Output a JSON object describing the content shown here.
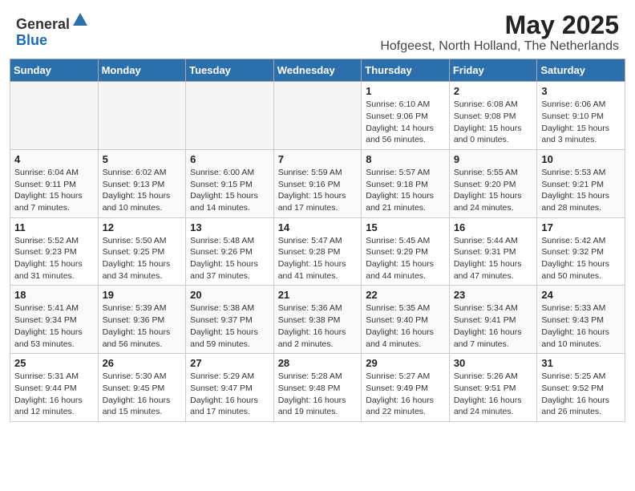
{
  "header": {
    "logo_line1": "General",
    "logo_line2": "Blue",
    "month_year": "May 2025",
    "location": "Hofgeest, North Holland, The Netherlands"
  },
  "days_of_week": [
    "Sunday",
    "Monday",
    "Tuesday",
    "Wednesday",
    "Thursday",
    "Friday",
    "Saturday"
  ],
  "weeks": [
    [
      {
        "num": "",
        "empty": true
      },
      {
        "num": "",
        "empty": true
      },
      {
        "num": "",
        "empty": true
      },
      {
        "num": "",
        "empty": true
      },
      {
        "num": "1",
        "sunrise": "6:10 AM",
        "sunset": "9:06 PM",
        "daylight": "14 hours and 56 minutes."
      },
      {
        "num": "2",
        "sunrise": "6:08 AM",
        "sunset": "9:08 PM",
        "daylight": "15 hours and 0 minutes."
      },
      {
        "num": "3",
        "sunrise": "6:06 AM",
        "sunset": "9:10 PM",
        "daylight": "15 hours and 3 minutes."
      }
    ],
    [
      {
        "num": "4",
        "sunrise": "6:04 AM",
        "sunset": "9:11 PM",
        "daylight": "15 hours and 7 minutes."
      },
      {
        "num": "5",
        "sunrise": "6:02 AM",
        "sunset": "9:13 PM",
        "daylight": "15 hours and 10 minutes."
      },
      {
        "num": "6",
        "sunrise": "6:00 AM",
        "sunset": "9:15 PM",
        "daylight": "15 hours and 14 minutes."
      },
      {
        "num": "7",
        "sunrise": "5:59 AM",
        "sunset": "9:16 PM",
        "daylight": "15 hours and 17 minutes."
      },
      {
        "num": "8",
        "sunrise": "5:57 AM",
        "sunset": "9:18 PM",
        "daylight": "15 hours and 21 minutes."
      },
      {
        "num": "9",
        "sunrise": "5:55 AM",
        "sunset": "9:20 PM",
        "daylight": "15 hours and 24 minutes."
      },
      {
        "num": "10",
        "sunrise": "5:53 AM",
        "sunset": "9:21 PM",
        "daylight": "15 hours and 28 minutes."
      }
    ],
    [
      {
        "num": "11",
        "sunrise": "5:52 AM",
        "sunset": "9:23 PM",
        "daylight": "15 hours and 31 minutes."
      },
      {
        "num": "12",
        "sunrise": "5:50 AM",
        "sunset": "9:25 PM",
        "daylight": "15 hours and 34 minutes."
      },
      {
        "num": "13",
        "sunrise": "5:48 AM",
        "sunset": "9:26 PM",
        "daylight": "15 hours and 37 minutes."
      },
      {
        "num": "14",
        "sunrise": "5:47 AM",
        "sunset": "9:28 PM",
        "daylight": "15 hours and 41 minutes."
      },
      {
        "num": "15",
        "sunrise": "5:45 AM",
        "sunset": "9:29 PM",
        "daylight": "15 hours and 44 minutes."
      },
      {
        "num": "16",
        "sunrise": "5:44 AM",
        "sunset": "9:31 PM",
        "daylight": "15 hours and 47 minutes."
      },
      {
        "num": "17",
        "sunrise": "5:42 AM",
        "sunset": "9:32 PM",
        "daylight": "15 hours and 50 minutes."
      }
    ],
    [
      {
        "num": "18",
        "sunrise": "5:41 AM",
        "sunset": "9:34 PM",
        "daylight": "15 hours and 53 minutes."
      },
      {
        "num": "19",
        "sunrise": "5:39 AM",
        "sunset": "9:36 PM",
        "daylight": "15 hours and 56 minutes."
      },
      {
        "num": "20",
        "sunrise": "5:38 AM",
        "sunset": "9:37 PM",
        "daylight": "15 hours and 59 minutes."
      },
      {
        "num": "21",
        "sunrise": "5:36 AM",
        "sunset": "9:38 PM",
        "daylight": "16 hours and 2 minutes."
      },
      {
        "num": "22",
        "sunrise": "5:35 AM",
        "sunset": "9:40 PM",
        "daylight": "16 hours and 4 minutes."
      },
      {
        "num": "23",
        "sunrise": "5:34 AM",
        "sunset": "9:41 PM",
        "daylight": "16 hours and 7 minutes."
      },
      {
        "num": "24",
        "sunrise": "5:33 AM",
        "sunset": "9:43 PM",
        "daylight": "16 hours and 10 minutes."
      }
    ],
    [
      {
        "num": "25",
        "sunrise": "5:31 AM",
        "sunset": "9:44 PM",
        "daylight": "16 hours and 12 minutes."
      },
      {
        "num": "26",
        "sunrise": "5:30 AM",
        "sunset": "9:45 PM",
        "daylight": "16 hours and 15 minutes."
      },
      {
        "num": "27",
        "sunrise": "5:29 AM",
        "sunset": "9:47 PM",
        "daylight": "16 hours and 17 minutes."
      },
      {
        "num": "28",
        "sunrise": "5:28 AM",
        "sunset": "9:48 PM",
        "daylight": "16 hours and 19 minutes."
      },
      {
        "num": "29",
        "sunrise": "5:27 AM",
        "sunset": "9:49 PM",
        "daylight": "16 hours and 22 minutes."
      },
      {
        "num": "30",
        "sunrise": "5:26 AM",
        "sunset": "9:51 PM",
        "daylight": "16 hours and 24 minutes."
      },
      {
        "num": "31",
        "sunrise": "5:25 AM",
        "sunset": "9:52 PM",
        "daylight": "16 hours and 26 minutes."
      }
    ]
  ],
  "labels": {
    "sunrise": "Sunrise:",
    "sunset": "Sunset:",
    "daylight": "Daylight:"
  }
}
